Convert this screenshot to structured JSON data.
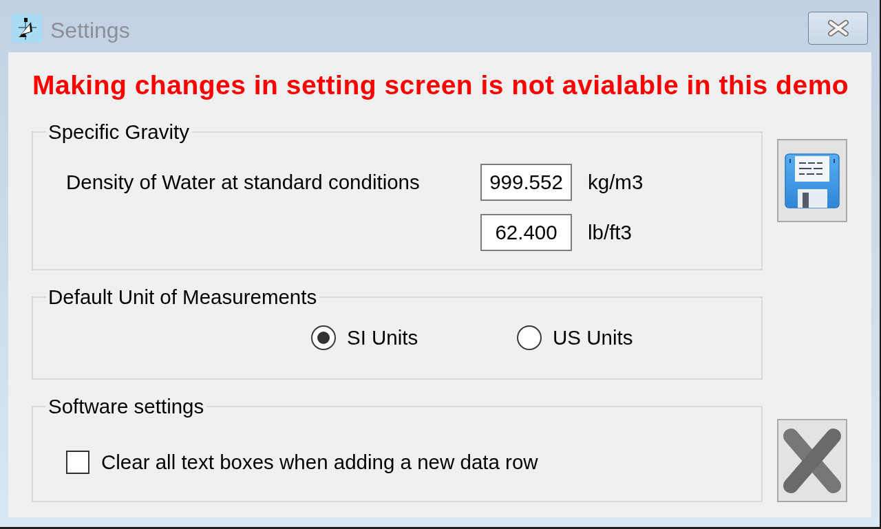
{
  "window": {
    "title": "Settings"
  },
  "warning": "Making changes in setting screen is not avialable in this demo",
  "specific_gravity": {
    "title": "Specific Gravity",
    "label": "Density of Water at standard conditions",
    "fields": [
      {
        "value": "999.552",
        "unit": "kg/m3"
      },
      {
        "value": "62.400",
        "unit": "lb/ft3"
      }
    ]
  },
  "default_unit": {
    "title": "Default Unit of Measurements",
    "options": [
      {
        "label": "SI Units",
        "selected": true
      },
      {
        "label": "US Units",
        "selected": false
      }
    ]
  },
  "software_settings": {
    "title": "Software settings",
    "options": [
      {
        "label": "Clear all text boxes when adding a new data row",
        "checked": false
      }
    ]
  }
}
